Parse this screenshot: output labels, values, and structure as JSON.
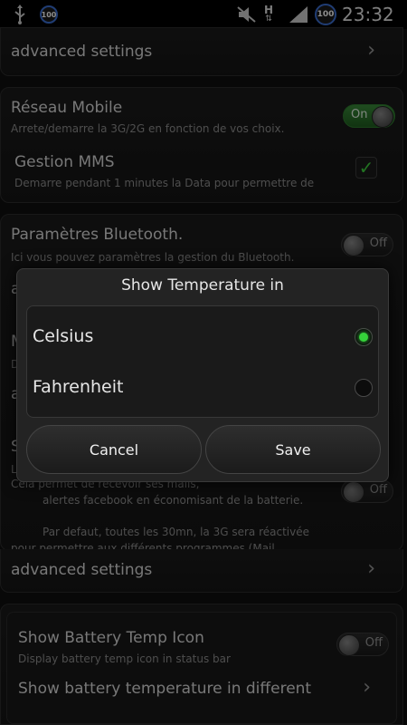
{
  "status_bar": {
    "left_icons": [
      "usb-icon",
      "battery-100-icon"
    ],
    "right_icons": [
      "mute-icon",
      "h-plus-data-icon",
      "signal-icon",
      "battery-100-icon"
    ],
    "badge_text": "100",
    "data_type": "H",
    "time": "23:32"
  },
  "settings": {
    "advanced_top": {
      "label": "advanced settings"
    },
    "reseau_mobile": {
      "title": "Réseau Mobile",
      "subtitle": "Arrete/demarre la 3G/2G en fonction de vos choix.",
      "toggle": "On"
    },
    "gestion_mms": {
      "title": "Gestion MMS",
      "subtitle": "Demarre pendant 1 minutes la Data pour permettre de"
    },
    "bluetooth": {
      "title": "Paramètres Bluetooth.",
      "subtitle": "Ici vous pouvez paramètres la gestion du Bluetooth.",
      "toggle": "Off"
    },
    "partial_letters": [
      "a",
      "M",
      "D",
      "a",
      "S",
      "L"
    ],
    "sync": {
      "line1": "Cela permet de recevoir ses mails,",
      "line2": "alertes facebook en économisant de la batterie.",
      "line3": "Par defaut, toutes les 30mn, la 3G sera réactivée",
      "line4": "pour permettre aux différents programmes (Mail",
      "toggle": "Off"
    },
    "advanced_bottom": {
      "label": "advanced settings"
    },
    "battery_icon": {
      "title": "Show Battery Temp Icon",
      "subtitle": "Display battery temp icon in status bar",
      "toggle": "Off"
    },
    "battery_temp_units": {
      "title": "Show battery temperature in different"
    }
  },
  "dialog": {
    "title": "Show Temperature in",
    "options": [
      {
        "label": "Celsius",
        "selected": true
      },
      {
        "label": "Fahrenheit",
        "selected": false
      }
    ],
    "cancel_label": "Cancel",
    "save_label": "Save"
  },
  "colors": {
    "accent_green": "#35d23a",
    "badge_blue": "#3b6fd4",
    "background": "#101010"
  }
}
